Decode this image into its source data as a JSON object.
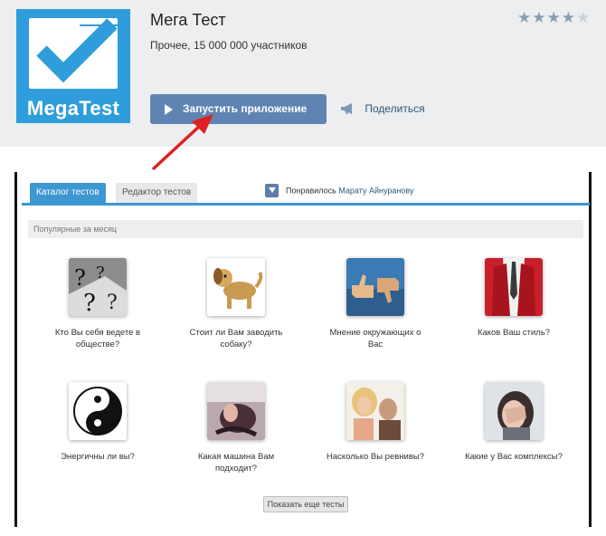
{
  "app": {
    "title": "Мега Тест",
    "meta": "Прочее, 15 000 000 участников",
    "logo_text": "MegaTest",
    "rating": {
      "filled": 4,
      "total": 5,
      "glyph_on": "★★★★",
      "glyph_off": "★"
    },
    "launch_label": "Запустить приложение",
    "share_label": "Поделиться",
    "colors": {
      "accent": "#5f84b4",
      "logo": "#2f9ddb",
      "arrow": "#e02020"
    }
  },
  "frame": {
    "tabs": [
      {
        "label": "Каталог тестов",
        "active": true
      },
      {
        "label": "Редактор тестов",
        "active": false
      }
    ],
    "liked_text": "Понравилось",
    "liked_person": "Марату Айнуранову",
    "section_title": "Популярные за месяц",
    "tests": [
      {
        "label": "Кто Вы себя ведете в обществе?",
        "icon": "question-marks-icon"
      },
      {
        "label": "Стоит ли Вам заводить собаку?",
        "icon": "dog-icon"
      },
      {
        "label": "Мнение окружающих о Вас",
        "icon": "thumbs-up-down-icon"
      },
      {
        "label": "Каков Ваш стиль?",
        "icon": "suit-icon"
      },
      {
        "label": "Энергичны ли вы?",
        "icon": "yin-yang-icon"
      },
      {
        "label": "Какая машина Вам подходит?",
        "icon": "car-interior-icon"
      },
      {
        "label": "Насколько Вы ревнивы?",
        "icon": "couple-icon"
      },
      {
        "label": "Какие у Вас комплексы?",
        "icon": "covering-face-icon"
      }
    ],
    "more_label": "Показать еще тесты",
    "colors": {
      "tab_active": "#3d97d1"
    }
  }
}
